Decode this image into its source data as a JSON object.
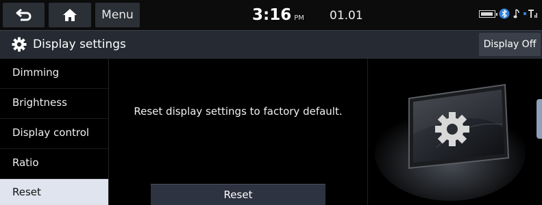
{
  "status_bar": {
    "menu_label": "Menu",
    "time": "3:16",
    "ampm": "PM",
    "date": "01.01"
  },
  "header": {
    "title": "Display settings",
    "display_off_label": "Display Off"
  },
  "sidebar": {
    "items": [
      {
        "label": "Dimming"
      },
      {
        "label": "Brightness"
      },
      {
        "label": "Display control"
      },
      {
        "label": "Ratio"
      },
      {
        "label": "Reset",
        "selected": true
      }
    ]
  },
  "main": {
    "message": "Reset display settings to factory default.",
    "reset_label": "Reset"
  },
  "icons": {
    "back": "back-arrow-icon",
    "home": "home-icon",
    "settings": "gear-icon",
    "battery": "battery-icon",
    "bluetooth": "bluetooth-icon",
    "music": "music-note-icon",
    "signal": "signal-icon"
  },
  "colors": {
    "selected_bg": "#dfe4ee",
    "header_bg": "#262b33",
    "button_bg": "#2d3340"
  }
}
